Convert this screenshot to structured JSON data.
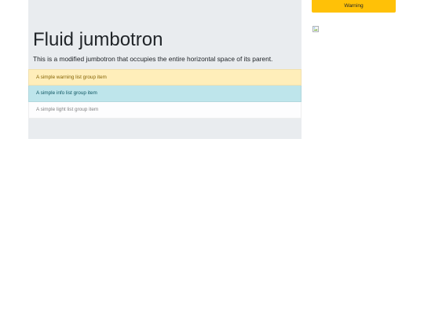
{
  "jumbotron": {
    "title": "Fluid jumbotron",
    "lead": "This is a modified jumbotron that occupies the entire horizontal space of its parent."
  },
  "list_group": {
    "items": [
      {
        "label": "A simple warning list group item",
        "variant": "warning"
      },
      {
        "label": "A simple info list group item",
        "variant": "info"
      },
      {
        "label": "A simple light list group item",
        "variant": "light"
      }
    ]
  },
  "sidebar": {
    "warning_button_label": "Warning",
    "image_icon": "broken-image-icon"
  },
  "colors": {
    "jumbotron_bg": "#e9ecef",
    "warning": "#ffc107",
    "warning_item_bg": "#ffeeba",
    "info_item_bg": "#bee5eb",
    "light_item_bg": "#fdfdfe"
  }
}
